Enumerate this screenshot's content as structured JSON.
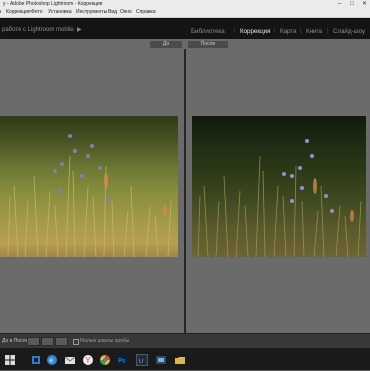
{
  "window": {
    "title": "у - Adobe Photoshop Lightroom - Коррекция"
  },
  "menu": [
    "ка",
    "Коррекция",
    "Фото",
    "Установка",
    "Инструменты",
    "Вид",
    "Окно",
    "Справка"
  ],
  "header": {
    "mobile_text": "работе с Lightroom mobile"
  },
  "modules": [
    "Библиотека",
    "Коррекция",
    "Карта",
    "Книга",
    "Слайд-шоу"
  ],
  "active_module": "Коррекция",
  "compare": {
    "before_label": "До",
    "after_label": "После"
  },
  "toolbar": {
    "label": "До и После:",
    "checkbox_label": "Малые шкалы пробы"
  },
  "colors": {
    "panel": "#6b6b6b",
    "header": "#141414",
    "accent": "#e9e9e9"
  },
  "taskbar_icons": [
    "windows-icon",
    "search-icon",
    "task-view-icon",
    "edge-icon",
    "explorer-icon",
    "mail-icon",
    "yandex-icon",
    "chrome-icon",
    "photoshop-icon",
    "lightroom-icon",
    "folder-icon",
    "app-icon"
  ]
}
